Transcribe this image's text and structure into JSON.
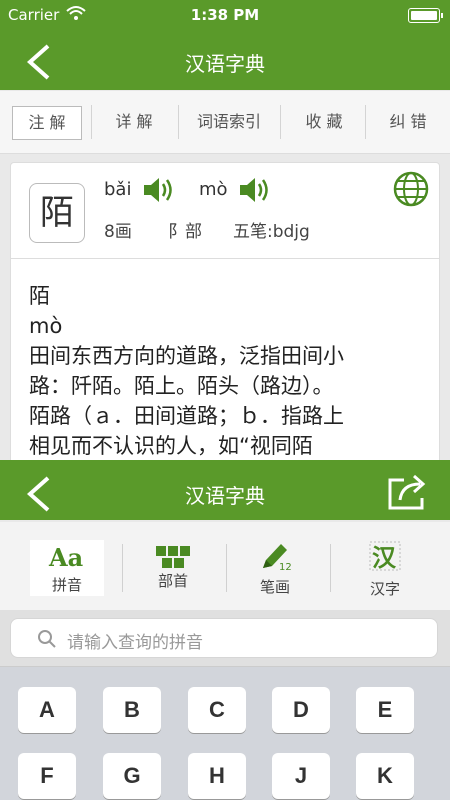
{
  "status_bar": {
    "carrier": "Carrier",
    "time": "1:38 PM"
  },
  "top_nav": {
    "title": "汉语字典"
  },
  "tabs": [
    {
      "label": "注 解",
      "active": true
    },
    {
      "label": "详 解"
    },
    {
      "label": "词语索引"
    },
    {
      "label": "收 藏"
    },
    {
      "label": "纠 错"
    }
  ],
  "entry": {
    "character": "陌",
    "pinyin_1": "bǎi",
    "pinyin_2": "mò",
    "strokes": "8画",
    "radical": "阝部",
    "wubi": "五笔:bdjg",
    "definition_lines": [
      "陌",
      "mò",
      "田间东西方向的道路，泛指田间小",
      "路：阡陌。陌上。陌头（路边）。",
      "陌路（ａ．田间道路；ｂ．指路上",
      "相见而不认识的人，如“视同陌"
    ]
  },
  "bottom_nav": {
    "title": "汉语字典"
  },
  "lookup_tabs": [
    {
      "label": "拼音",
      "icon": "pinyin-icon",
      "active": true
    },
    {
      "label": "部首",
      "icon": "radical-icon"
    },
    {
      "label": "笔画",
      "icon": "pencil-icon"
    },
    {
      "label": "汉字",
      "icon": "hanzi-icon"
    }
  ],
  "search": {
    "placeholder": "请输入查询的拼音"
  },
  "keyboard": {
    "row1": [
      "A",
      "B",
      "C",
      "D",
      "E"
    ],
    "row2": [
      "F",
      "G",
      "H",
      "J",
      "K"
    ]
  },
  "colors": {
    "brand_green": "#5a9a2a",
    "icon_green": "#4a8a22"
  }
}
